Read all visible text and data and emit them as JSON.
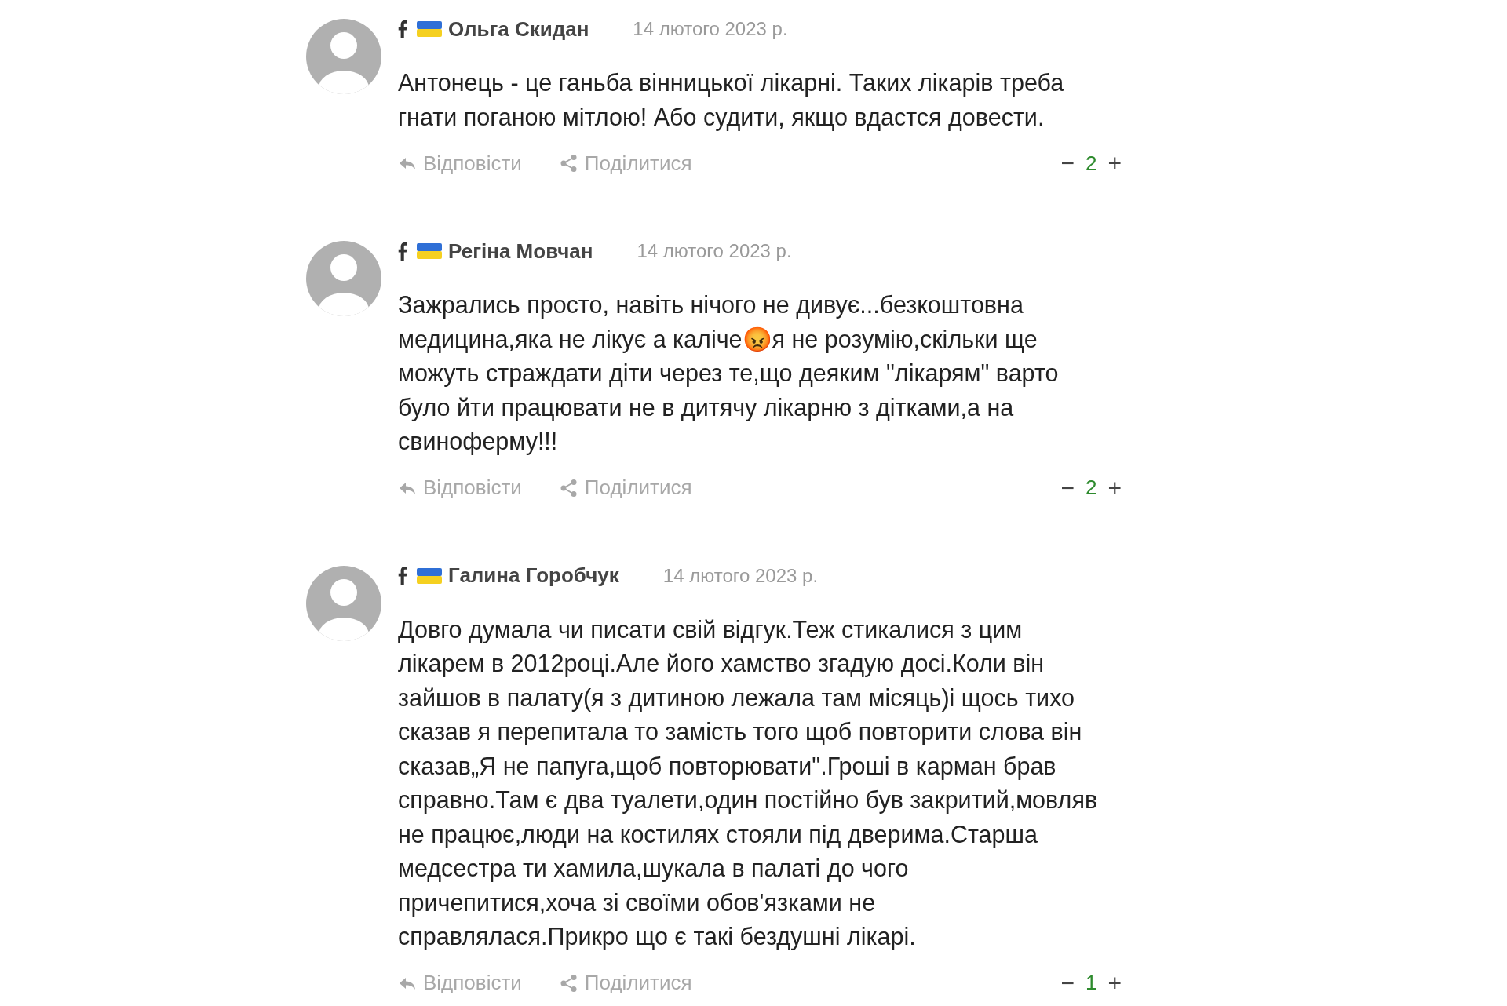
{
  "comments": [
    {
      "author": "Ольга Скидан",
      "date": "14 лютого 2023 р.",
      "lines": [
        "Антонець - це ганьба вінницької лікарні. Таких лікарів треба",
        "гнати поганою мітлою! Або судити, якщо вдастся довести."
      ],
      "reply": "Відповісти",
      "share": "Поділитися",
      "minus": "−",
      "count": "2",
      "plus": "+"
    },
    {
      "author": "Регіна Мовчан",
      "date": "14 лютого 2023 р.",
      "lines": [
        "Зажрались просто, навіть нічого не дивує...безкоштовна",
        "медицина,яка не лікує а каліче😡я не розумію,скільки ще",
        "можуть страждати діти через те,що деяким \"лікарям\" варто",
        "було йти працювати не в дитячу лікарню з дітками,а на",
        "свиноферму!!!"
      ],
      "reply": "Відповісти",
      "share": "Поділитися",
      "minus": "−",
      "count": "2",
      "plus": "+"
    },
    {
      "author": "Галина Горобчук",
      "date": "14 лютого 2023 р.",
      "lines": [
        "Довго думала чи писати свій відгук.Теж стикалися з цим",
        "лікарем в 2012році.Але його хамство згадую досі.Коли він",
        "зайшов в палату(я з дитиною лежала там місяць)і щось тихо",
        "сказав я перепитала то замість того щоб повторити слова він",
        "сказав„Я не папуга,щоб повторювати\".Гроші в карман брав",
        "справно.Там є два туалети,один постійно був закритий,мовляв",
        "не працює,люди на костилях стояли під дверима.Старша",
        "медсестра ти хамила,шукала в палаті до чого",
        "причепитися,хоча зі своїми обов'язками не",
        "справлялася.Прикро що є такі бездушні лікарі."
      ],
      "reply": "Відповісти",
      "share": "Поділитися",
      "minus": "−",
      "count": "1",
      "plus": "+"
    }
  ]
}
